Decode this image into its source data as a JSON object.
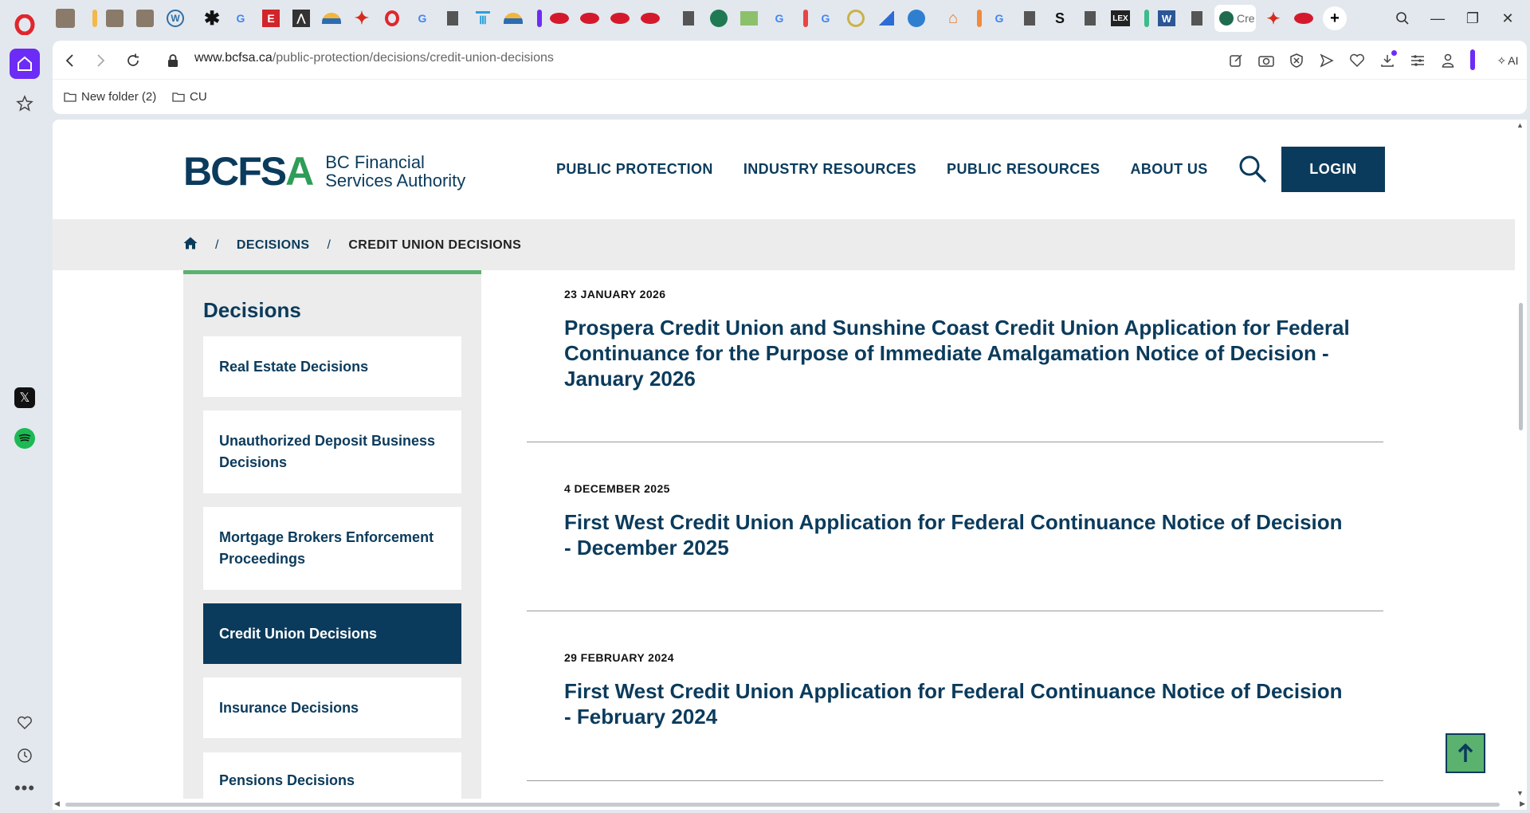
{
  "browser": {
    "url_domain": "www.bcfsa.ca",
    "url_path": "/public-protection/decisions/credit-union-decisions",
    "active_tab_label": "Cre",
    "ai_label": "AI",
    "bookmarks": [
      {
        "label": "New folder (2)"
      },
      {
        "label": "CU"
      }
    ]
  },
  "site": {
    "logo_mark_main": "BCFS",
    "logo_mark_accent": "A",
    "logo_line1": "BC Financial",
    "logo_line2": "Services Authority",
    "nav": [
      "PUBLIC PROTECTION",
      "INDUSTRY RESOURCES",
      "PUBLIC RESOURCES",
      "ABOUT US"
    ],
    "login": "LOGIN"
  },
  "breadcrumb": {
    "items": [
      "DECISIONS",
      "CREDIT UNION DECISIONS"
    ],
    "separator": "/"
  },
  "sidenav": {
    "title": "Decisions",
    "items": [
      {
        "label": "Real Estate Decisions"
      },
      {
        "label": "Unauthorized Deposit Business Decisions"
      },
      {
        "label": "Mortgage Brokers Enforcement Proceedings"
      },
      {
        "label": "Credit Union Decisions",
        "active": true
      },
      {
        "label": "Insurance Decisions"
      },
      {
        "label": "Pensions Decisions"
      }
    ]
  },
  "decisions": [
    {
      "date": "23 JANUARY 2026",
      "title": "Prospera Credit Union and Sunshine Coast Credit Union Application for Federal Continuance for the Purpose of Immediate Amalgamation Notice of Decision - January 2026"
    },
    {
      "date": "4 DECEMBER 2025",
      "title": "First West Credit Union Application for Federal Continuance Notice of Decision - December 2025"
    },
    {
      "date": "29 FEBRUARY 2024",
      "title": "First West Credit Union Application for Federal Continuance Notice of Decision - February 2024"
    }
  ],
  "colors": {
    "brand_navy": "#0b3b5c",
    "brand_green": "#5bb26e"
  }
}
